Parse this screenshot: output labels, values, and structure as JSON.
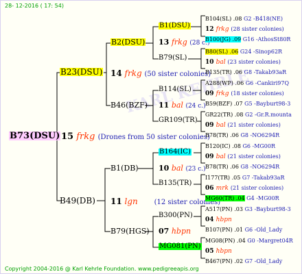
{
  "header": {
    "date": "28- 12-2016 ( 17: 54)",
    "footer": "Copyright 2004-2016 @ Karl Kehrle Foundation.   www.pedigreeapis.org"
  },
  "root": {
    "name": "B73(DSU)",
    "num": "15",
    "drone": "frkg",
    "note": "(Drones from 50 sister colonies)"
  },
  "gen1": [
    {
      "name": "B23(DSU)",
      "num": "14",
      "drone": "frkg",
      "note": "(50 sister colonies)"
    },
    {
      "name": "B49(DB)",
      "num": "11",
      "drone": "lgn",
      "note": "(12 sister colonies)"
    }
  ],
  "gen2": [
    {
      "name": "B2(DSU)",
      "num": "13",
      "drone": "frkg",
      "note": "(28 c.)"
    },
    {
      "name": "B46(BZF)",
      "num": "11",
      "drone": "bal",
      "note": "(24 c.)"
    },
    {
      "name": "B1(DB)",
      "num": "10",
      "drone": "bal",
      "note": "(23 c.)"
    },
    {
      "name": "B79(HGS)",
      "num": "07",
      "drone": "hbpn",
      "note": ""
    }
  ],
  "gen3": [
    {
      "name": "B1(DSU)",
      "num": "12",
      "drone": "frkg",
      "note": "(28 sister colonies)"
    },
    {
      "name": "B79(SL)",
      "num": "",
      "drone": "",
      "note": ""
    },
    {
      "name": "B114(SL)",
      "num": "09",
      "drone": "frkg",
      "note": "(18 sister colonies)"
    },
    {
      "name": "GR109(TR)",
      "num": "",
      "drone": "",
      "note": ""
    },
    {
      "name": "B164(IC)",
      "num": "",
      "drone": "",
      "note": ""
    },
    {
      "name": "B135(TR)",
      "num": "",
      "drone": "",
      "note": ""
    },
    {
      "name": "B300(PN)",
      "num": "",
      "drone": "",
      "note": ""
    },
    {
      "name": "MG081(PN)",
      "num": "",
      "drone": "",
      "note": ""
    }
  ],
  "gen4": [
    {
      "left": "B104(SL) .08",
      "right": "G2 -B418(NE)"
    },
    {
      "num": "12",
      "drone": "frkg",
      "note": "(28 sister colonies)"
    },
    {
      "left": "B100(JG) .09",
      "right": "G16 -AthosSt80R"
    },
    {
      "left": "B80(SL) .06",
      "right": "G24 -Sinop62R"
    },
    {
      "num": "10",
      "drone": "bal",
      "note": "(23 sister colonies)"
    },
    {
      "left": "B135(TR) .06",
      "right": "G8 -Takab93aR"
    },
    {
      "left": "A288(WP) .06",
      "right": "G6 -Cankiri97Q"
    },
    {
      "num": "09",
      "drone": "frkg",
      "note": "(18 sister colonies)"
    },
    {
      "left": "B59(BZF) .07",
      "right": "G5 -Bayburt98-3"
    },
    {
      "left": "GR22(TR) .08",
      "right": "G2 -Gr.R.mounta"
    },
    {
      "num": "09",
      "drone": "bal",
      "note": "(21 sister colonies)"
    },
    {
      "left": "B78(TR) .06",
      "right": "G8 -NO6294R"
    },
    {
      "left": "B120(IC) .08",
      "right": "G6 -MG00R"
    },
    {
      "num": "09",
      "drone": "bal",
      "note": "(21 sister colonies)"
    },
    {
      "left": "B78(TR) .06",
      "right": "G8 -NO6294R"
    },
    {
      "left": "I177(TR) .05",
      "right": "G7 -Takab93aR"
    },
    {
      "num": "06",
      "drone": "mrk",
      "note": "(21 sister colonies)"
    },
    {
      "left": "MG60(TR) .04",
      "right": "G4 -MG00R"
    },
    {
      "left": "A517(PN) .03",
      "right": "G3 -Bayburt98-3"
    },
    {
      "num": "04",
      "drone": "hbpn",
      "note": ""
    },
    {
      "left": "B107(PN) .01",
      "right": "G6 -Old_Lady"
    },
    {
      "left": "MG08(PN) .04",
      "right": "G0 -Margret04R"
    },
    {
      "num": "05",
      "drone": "hbpn",
      "note": ""
    },
    {
      "left": "B467(PN) .02",
      "right": "G7 -Old_Lady"
    }
  ]
}
